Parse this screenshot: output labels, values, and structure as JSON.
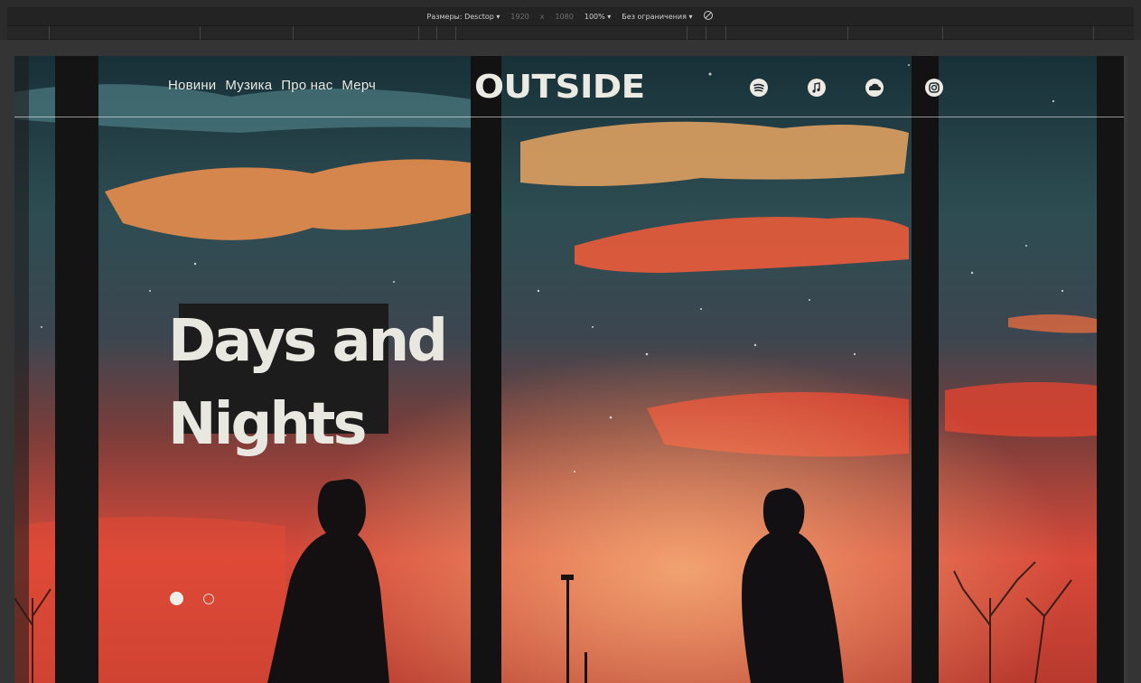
{
  "devtools": {
    "size_label": "Размеры: Desctop ▾",
    "width": "1920",
    "times": "x",
    "height": "1080",
    "zoom": "100% ▾",
    "throttle": "Без ограничения ▾"
  },
  "nav": {
    "links": [
      "Новини",
      "Музика",
      "Про нас",
      "Мерч"
    ],
    "logo": "OUTSIDE",
    "social_icons": [
      "spotify-icon",
      "apple-music-icon",
      "soundcloud-icon",
      "instagram-icon"
    ]
  },
  "hero": {
    "title_line1": "Days and",
    "title_line2": "Nights",
    "slide_count": 2,
    "active_slide": 1
  },
  "colors": {
    "text_light": "#e9e8e0",
    "title_backdrop": "#1c1c1c",
    "sky_teal": "#2c4a50",
    "sky_orange": "#e8884a",
    "sky_red": "#e2432f"
  }
}
